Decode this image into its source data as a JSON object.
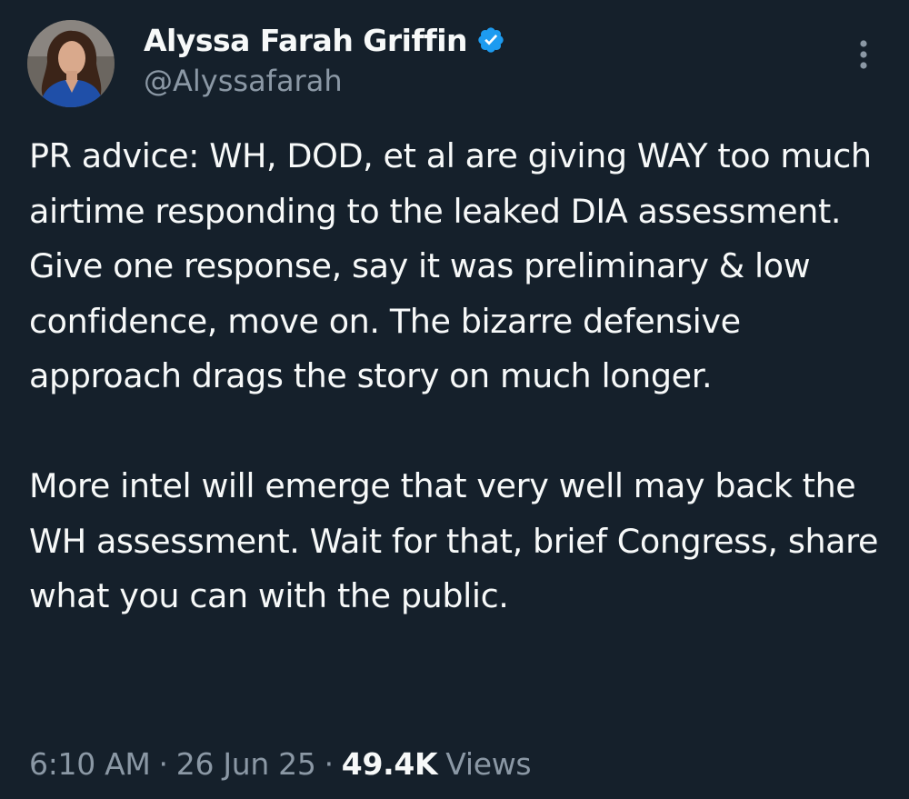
{
  "author": {
    "display_name": "Alyssa Farah Griffin",
    "handle": "@Alyssafarah",
    "verified": true
  },
  "tweet": {
    "paragraphs": [
      "PR advice: WH, DOD, et al are giving WAY too much airtime responding to the leaked DIA assessment. Give one response, say it was preliminary & low confidence, move on. The bizarre defensive approach drags the story on much longer.",
      "More intel will emerge that very well may back the WH assessment. Wait for that, brief Congress, share what you can with the public."
    ]
  },
  "meta": {
    "time": "6:10 AM",
    "date": "26 Jun 25",
    "separator": "·",
    "views_count": "49.4K",
    "views_label": "Views"
  },
  "icons": {
    "verified": "verified-badge-icon",
    "more": "more-vertical-icon"
  },
  "colors": {
    "background": "#15202b",
    "primary_text": "#f7f9f9",
    "secondary_text": "#8b98a5",
    "verified_blue": "#1d9bf0"
  }
}
